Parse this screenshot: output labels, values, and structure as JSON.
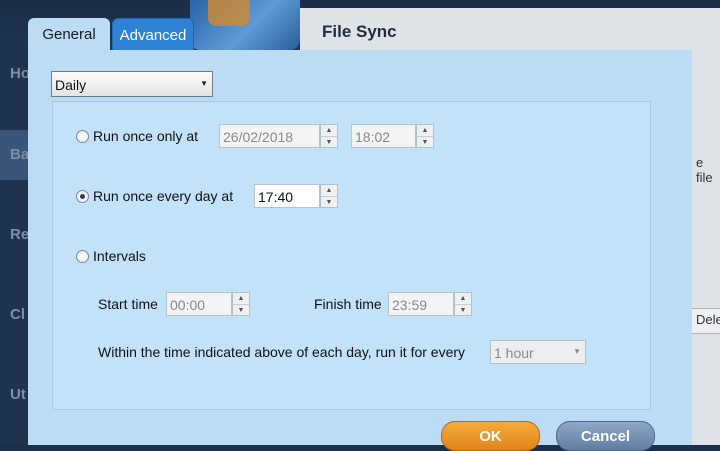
{
  "background": {
    "title": "File Sync",
    "sidebar_items": [
      "Ho",
      "Ba",
      "Re",
      "Cl",
      "Ut"
    ],
    "right_texts": [
      "e file",
      "Dele"
    ]
  },
  "dialog": {
    "tabs": [
      {
        "label": "General",
        "active": true
      },
      {
        "label": "Advanced",
        "active": false
      }
    ],
    "schedule_type": {
      "selected": "Daily"
    },
    "run_once": {
      "label": "Run once only at",
      "selected": false,
      "date": "26/02/2018",
      "time": "18:02"
    },
    "run_daily": {
      "label": "Run once every day at",
      "selected": true,
      "time": "17:40"
    },
    "intervals": {
      "label": "Intervals",
      "selected": false,
      "start_label": "Start time",
      "start_value": "00:00",
      "finish_label": "Finish time",
      "finish_value": "23:59",
      "repeat_label": "Within the time indicated above of each day, run it for every",
      "repeat_value": "1 hour"
    },
    "buttons": {
      "ok": "OK",
      "cancel": "Cancel"
    }
  },
  "colors": {
    "accent": "#2d82d6",
    "ok": "#f0961f",
    "cancel": "#7691b4",
    "panel": "#bcdcf5"
  }
}
